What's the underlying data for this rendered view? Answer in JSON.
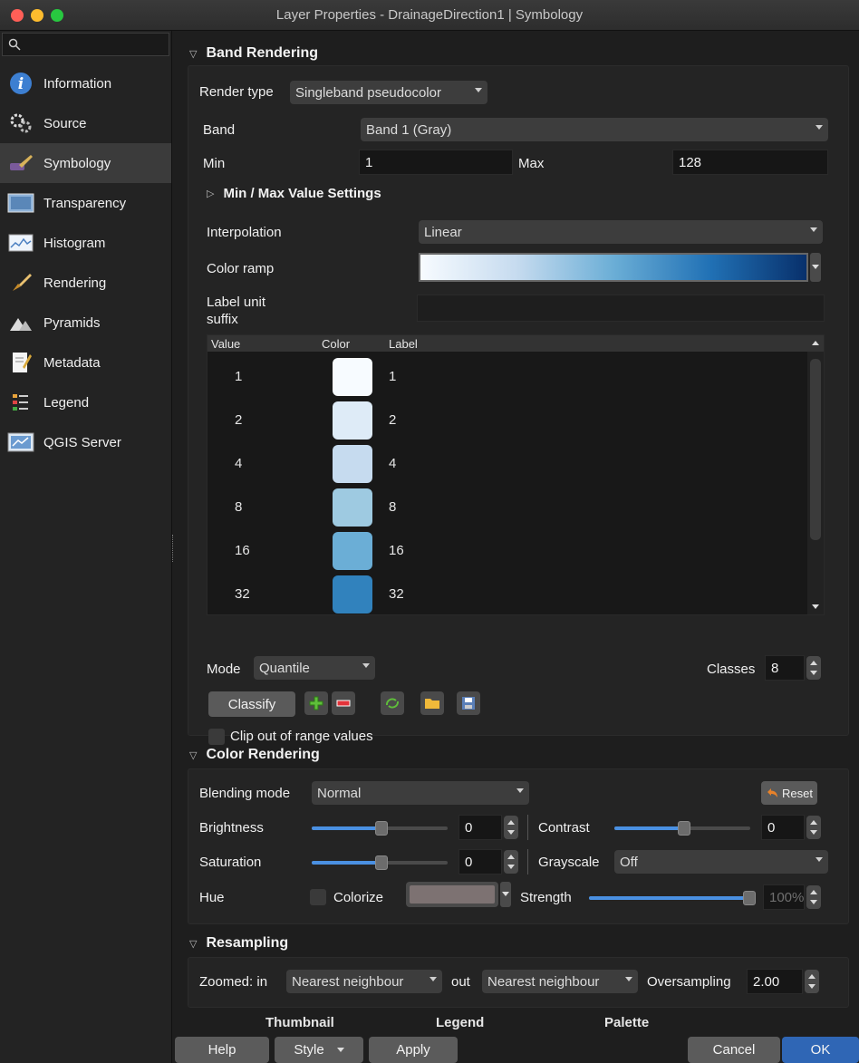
{
  "window": {
    "title": "Layer Properties - DrainageDirection1 | Symbology"
  },
  "sidebar": {
    "search_placeholder": "",
    "items": [
      {
        "label": "Information",
        "icon": "info-icon"
      },
      {
        "label": "Source",
        "icon": "source-icon"
      },
      {
        "label": "Symbology",
        "icon": "symbology-brush-icon",
        "active": true
      },
      {
        "label": "Transparency",
        "icon": "transparency-icon"
      },
      {
        "label": "Histogram",
        "icon": "histogram-icon"
      },
      {
        "label": "Rendering",
        "icon": "rendering-brush-icon"
      },
      {
        "label": "Pyramids",
        "icon": "pyramids-icon"
      },
      {
        "label": "Metadata",
        "icon": "metadata-icon"
      },
      {
        "label": "Legend",
        "icon": "legend-icon"
      },
      {
        "label": "QGIS Server",
        "icon": "qgis-server-icon"
      }
    ]
  },
  "band_rendering": {
    "header": "Band Rendering",
    "render_type_label": "Render type",
    "render_type_value": "Singleband pseudocolor",
    "band_label": "Band",
    "band_value": "Band 1 (Gray)",
    "min_label": "Min",
    "min_value": "1",
    "max_label": "Max",
    "max_value": "128",
    "minmax_settings": "Min / Max Value Settings",
    "interpolation_label": "Interpolation",
    "interpolation_value": "Linear",
    "color_ramp_label": "Color ramp",
    "color_ramp_from": "#f7fbff",
    "color_ramp_to": "#08306b",
    "label_unit_label_1": "Label unit",
    "label_unit_label_2": "suffix",
    "label_unit_value": "",
    "table": {
      "headers": {
        "value": "Value",
        "color": "Color",
        "label": "Label"
      },
      "rows": [
        {
          "value": "1",
          "color": "#f7fbff",
          "label": "1"
        },
        {
          "value": "2",
          "color": "#deebf7",
          "label": "2"
        },
        {
          "value": "4",
          "color": "#c6dbef",
          "label": "4"
        },
        {
          "value": "8",
          "color": "#9ecae1",
          "label": "8"
        },
        {
          "value": "16",
          "color": "#6baed6",
          "label": "16"
        },
        {
          "value": "32",
          "color": "#3182bd",
          "label": "32"
        }
      ]
    },
    "mode_label": "Mode",
    "mode_value": "Quantile",
    "classes_label": "Classes",
    "classes_value": "8",
    "classify_button": "Classify",
    "clip_label": "Clip out of range values"
  },
  "color_rendering": {
    "header": "Color Rendering",
    "blending_label": "Blending mode",
    "blending_value": "Normal",
    "reset_button": "Reset",
    "brightness_label": "Brightness",
    "brightness_value": "0",
    "contrast_label": "Contrast",
    "contrast_value": "0",
    "saturation_label": "Saturation",
    "saturation_value": "0",
    "grayscale_label": "Grayscale",
    "grayscale_value": "Off",
    "hue_label": "Hue",
    "colorize_label": "Colorize",
    "strength_label": "Strength",
    "strength_value": "100%"
  },
  "resampling": {
    "header": "Resampling",
    "zoomed_in_label": "Zoomed: in",
    "zoomed_in_value": "Nearest neighbour",
    "out_label": "out",
    "out_value": "Nearest neighbour",
    "oversampling_label": "Oversampling",
    "oversampling_value": "2.00"
  },
  "footer_tabs": [
    "Thumbnail",
    "Legend",
    "Palette"
  ],
  "buttons": {
    "help": "Help",
    "style": "Style",
    "apply": "Apply",
    "cancel": "Cancel",
    "ok": "OK"
  }
}
